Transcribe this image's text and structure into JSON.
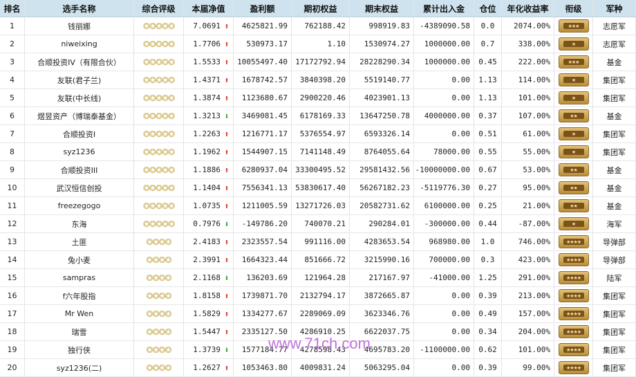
{
  "headers": [
    "排名",
    "选手名称",
    "综合评级",
    "本届净值",
    "盈利额",
    "期初权益",
    "期末权益",
    "累计出入金",
    "仓位",
    "年化收益率",
    "衔级",
    "军种"
  ],
  "rows": [
    {
      "rank": "1",
      "name": "钱丽娜",
      "stars": 5,
      "nav": "7.0691",
      "dir": "up",
      "profit": "4625821.99",
      "begin": "762188.42",
      "end": "998919.83",
      "flow": "-4389090.58",
      "pos": "0.0",
      "annual": "2074.00%",
      "badge": "★★★",
      "type": "志愿军"
    },
    {
      "rank": "2",
      "name": "niweixing",
      "stars": 5,
      "nav": "1.7706",
      "dir": "up",
      "profit": "530973.17",
      "begin": "1.10",
      "end": "1530974.27",
      "flow": "1000000.00",
      "pos": "0.7",
      "annual": "338.00%",
      "badge": "★",
      "type": "志愿军"
    },
    {
      "rank": "3",
      "name": "合顺投资IV（有限合伙）",
      "stars": 5,
      "nav": "1.5533",
      "dir": "up",
      "profit": "10055497.40",
      "begin": "17172792.94",
      "end": "28228290.34",
      "flow": "1000000.00",
      "pos": "0.45",
      "annual": "222.00%",
      "badge": "★★★",
      "type": "基金"
    },
    {
      "rank": "4",
      "name": "友联(君子兰)",
      "stars": 5,
      "nav": "1.4371",
      "dir": "up",
      "profit": "1678742.57",
      "begin": "3840398.20",
      "end": "5519140.77",
      "flow": "0.00",
      "pos": "1.13",
      "annual": "114.00%",
      "badge": "★",
      "type": "集团军"
    },
    {
      "rank": "5",
      "name": "友联(中长线)",
      "stars": 5,
      "nav": "1.3874",
      "dir": "up",
      "profit": "1123680.67",
      "begin": "2900220.46",
      "end": "4023901.13",
      "flow": "0.00",
      "pos": "1.13",
      "annual": "101.00%",
      "badge": "★",
      "type": "集团军"
    },
    {
      "rank": "6",
      "name": "煜昱资产（博瑞泰基金）",
      "stars": 5,
      "nav": "1.3213",
      "dir": "down",
      "profit": "3469081.45",
      "begin": "6178169.33",
      "end": "13647250.78",
      "flow": "4000000.00",
      "pos": "0.37",
      "annual": "107.00%",
      "badge": "★★",
      "type": "基金"
    },
    {
      "rank": "7",
      "name": "合顺投资I",
      "stars": 5,
      "nav": "1.2263",
      "dir": "up",
      "profit": "1216771.17",
      "begin": "5376554.97",
      "end": "6593326.14",
      "flow": "0.00",
      "pos": "0.51",
      "annual": "61.00%",
      "badge": "★",
      "type": "集团军"
    },
    {
      "rank": "8",
      "name": "syz1236",
      "stars": 5,
      "nav": "1.1962",
      "dir": "up",
      "profit": "1544907.15",
      "begin": "7141148.49",
      "end": "8764055.64",
      "flow": "78000.00",
      "pos": "0.55",
      "annual": "55.00%",
      "badge": "★",
      "type": "集团军"
    },
    {
      "rank": "9",
      "name": "合顺投资III",
      "stars": 5,
      "nav": "1.1886",
      "dir": "up",
      "profit": "6280937.04",
      "begin": "33300495.52",
      "end": "29581432.56",
      "flow": "-10000000.00",
      "pos": "0.67",
      "annual": "53.00%",
      "badge": "★★",
      "type": "基金"
    },
    {
      "rank": "10",
      "name": "武汉恒信创投",
      "stars": 5,
      "nav": "1.1404",
      "dir": "up",
      "profit": "7556341.13",
      "begin": "53830617.40",
      "end": "56267182.23",
      "flow": "-5119776.30",
      "pos": "0.27",
      "annual": "95.00%",
      "badge": "★★",
      "type": "基金"
    },
    {
      "rank": "11",
      "name": "freezegogo",
      "stars": 5,
      "nav": "1.0735",
      "dir": "up",
      "profit": "1211005.59",
      "begin": "13271726.03",
      "end": "20582731.62",
      "flow": "6100000.00",
      "pos": "0.25",
      "annual": "21.00%",
      "badge": "★★",
      "type": "基金"
    },
    {
      "rank": "12",
      "name": "东海",
      "stars": 5,
      "nav": "0.7976",
      "dir": "down",
      "profit": "-149786.20",
      "begin": "740070.21",
      "end": "290284.01",
      "flow": "-300000.00",
      "pos": "0.44",
      "annual": "-87.00%",
      "badge": "★",
      "type": "海军"
    },
    {
      "rank": "13",
      "name": "土匪",
      "stars": 4,
      "nav": "2.4183",
      "dir": "up",
      "profit": "2323557.54",
      "begin": "991116.00",
      "end": "4283653.54",
      "flow": "968980.00",
      "pos": "1.0",
      "annual": "746.00%",
      "badge": "★★★★",
      "type": "导弹部"
    },
    {
      "rank": "14",
      "name": "兔小麦",
      "stars": 4,
      "nav": "2.3991",
      "dir": "up",
      "profit": "1664323.44",
      "begin": "851666.72",
      "end": "3215990.16",
      "flow": "700000.00",
      "pos": "0.3",
      "annual": "423.00%",
      "badge": "★★★★",
      "type": "导弹部"
    },
    {
      "rank": "15",
      "name": "sampras",
      "stars": 4,
      "nav": "2.1168",
      "dir": "down",
      "profit": "136203.69",
      "begin": "121964.28",
      "end": "217167.97",
      "flow": "-41000.00",
      "pos": "1.25",
      "annual": "291.00%",
      "badge": "★★★★",
      "type": "陆军"
    },
    {
      "rank": "16",
      "name": "f六年股指",
      "stars": 4,
      "nav": "1.8158",
      "dir": "up",
      "profit": "1739871.70",
      "begin": "2132794.17",
      "end": "3872665.87",
      "flow": "0.00",
      "pos": "0.39",
      "annual": "213.00%",
      "badge": "★★★★",
      "type": "集团军"
    },
    {
      "rank": "17",
      "name": "Mr Wen",
      "stars": 4,
      "nav": "1.5829",
      "dir": "up",
      "profit": "1334277.67",
      "begin": "2289069.09",
      "end": "3623346.76",
      "flow": "0.00",
      "pos": "0.49",
      "annual": "157.00%",
      "badge": "★★★★",
      "type": "集团军"
    },
    {
      "rank": "18",
      "name": "瑞雪",
      "stars": 4,
      "nav": "1.5447",
      "dir": "up",
      "profit": "2335127.50",
      "begin": "4286910.25",
      "end": "6622037.75",
      "flow": "0.00",
      "pos": "0.34",
      "annual": "204.00%",
      "badge": "★★★★",
      "type": "集团军"
    },
    {
      "rank": "19",
      "name": "独行侠",
      "stars": 4,
      "nav": "1.3739",
      "dir": "down",
      "profit": "1577184.77",
      "begin": "4278598.43",
      "end": "4695783.20",
      "flow": "-1100000.00",
      "pos": "0.62",
      "annual": "101.00%",
      "badge": "★★★★",
      "type": "集团军"
    },
    {
      "rank": "20",
      "name": "syz1236(二)",
      "stars": 4,
      "nav": "1.2627",
      "dir": "up",
      "profit": "1053463.80",
      "begin": "4009831.24",
      "end": "5063295.04",
      "flow": "0.00",
      "pos": "0.39",
      "annual": "99.00%",
      "badge": "★★★★",
      "type": "集团军"
    }
  ],
  "watermark": "www.71ch.com",
  "colors": {
    "header_bg": "#cfe3ee",
    "up": "#e02020",
    "down": "#18a028",
    "badge": "#b98d3b"
  }
}
